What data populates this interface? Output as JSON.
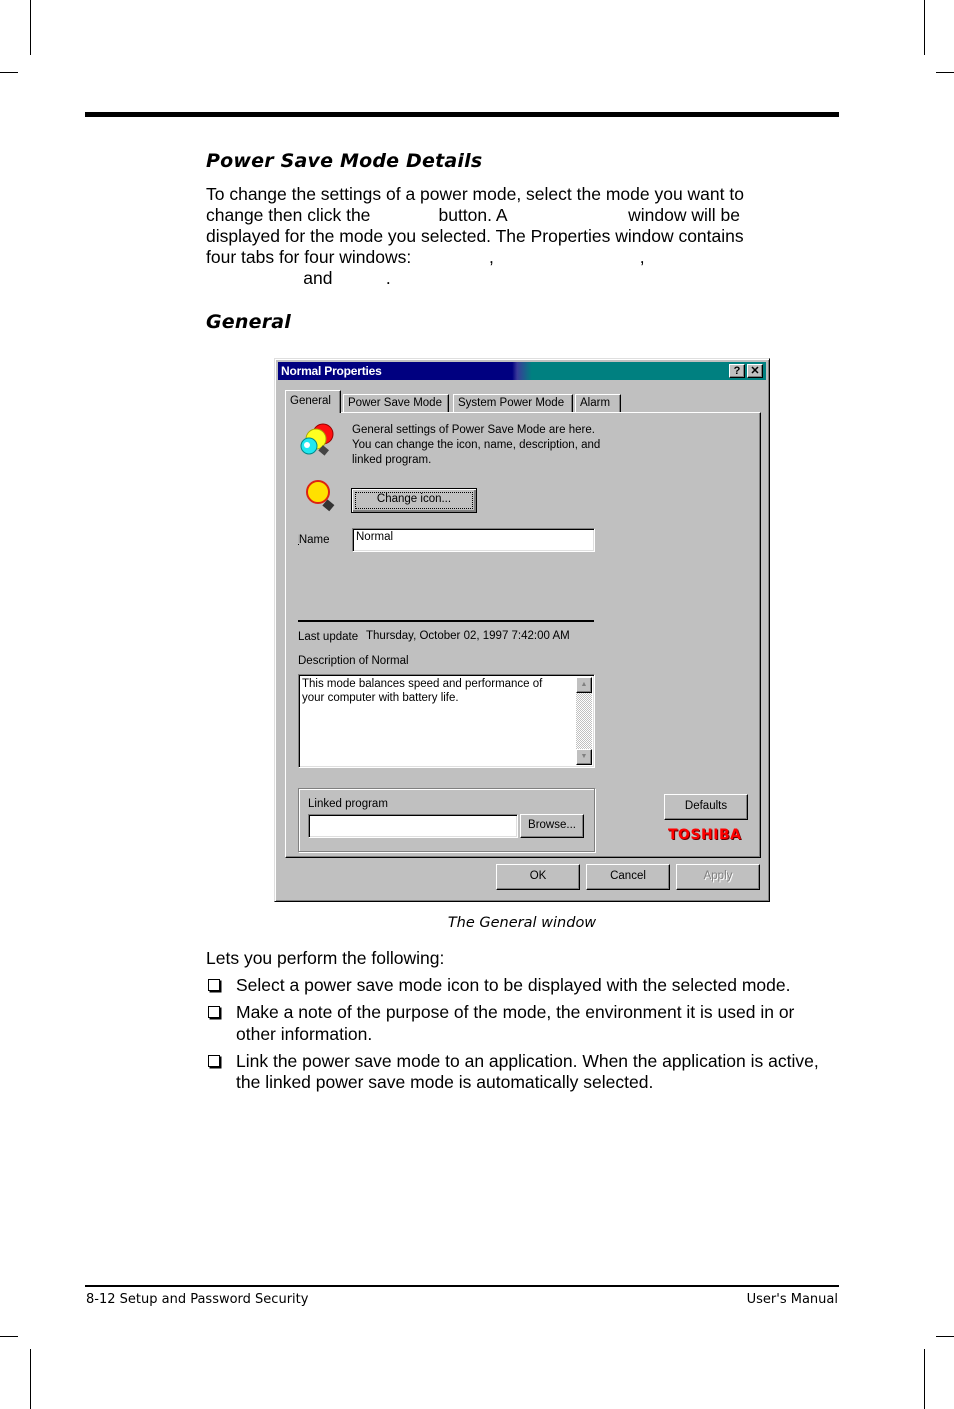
{
  "page": {
    "section_heading": "Power Save Mode Details",
    "intro_lines": [
      "To change the settings of a power mode, select the mode you want to",
      "change then click the              button. A                         window will be",
      "displayed for the mode you selected. The Properties window contains",
      "four tabs for four windows:                ,                              ,",
      "                    and           ."
    ],
    "subheading": "General",
    "figure_caption": "The General window",
    "lead_in": "Lets you perform the following:",
    "bullets": [
      "Select a power save mode icon to be displayed with the selected mode.",
      "Make a note of the purpose of the mode, the environment it is used in or other information.",
      "Link the power save mode to an application. When the application is active, the linked power save mode is automatically selected."
    ],
    "footer": {
      "left": "8-12  Setup and Password Security",
      "right": "User's Manual"
    }
  },
  "dialog": {
    "title": "Normal Properties",
    "help_glyph": "?",
    "close_glyph": "✕",
    "tabs": [
      "General",
      "Power Save Mode",
      "System Power Mode",
      "Alarm"
    ],
    "active_tab": "General",
    "info_text_lines": [
      "General settings of Power Save Mode are here.",
      "You can change the icon, name, description, and",
      "linked program."
    ],
    "change_icon_button": "Change icon...",
    "name_label": "Name",
    "name_value": "Normal",
    "last_update_label": "Last update",
    "last_update_value": "Thursday, October 02, 1997 7:42:00 AM",
    "description_label": "Description of Normal",
    "description_lines": [
      "This mode balances speed and performance of",
      "your computer with battery life."
    ],
    "linked_program_label": "Linked program",
    "linked_program_value": "",
    "browse_button": "Browse...",
    "defaults_button": "Defaults",
    "brand_logo": "TOSHIBA",
    "ok_button": "OK",
    "cancel_button": "Cancel",
    "apply_button": "Apply",
    "colors": {
      "title_active": "#000080",
      "title_gradient_end": "#008080",
      "face": "#c0c0c0",
      "brand_red": "#ff0000"
    }
  }
}
